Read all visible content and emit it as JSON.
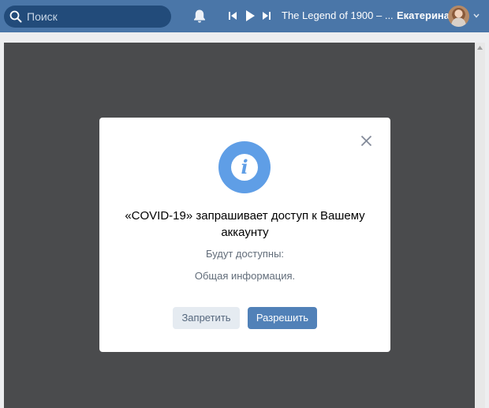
{
  "header": {
    "search_placeholder": "Поиск",
    "track_title": "The Legend of 1900 – ...",
    "user_name": "Екатерина",
    "icons": [
      "search-icon",
      "bell-icon",
      "prev-track-icon",
      "play-icon",
      "next-track-icon",
      "chevron-down-icon"
    ]
  },
  "dialog": {
    "title": "«COVID-19» запрашивает доступ к Вашему аккаунту",
    "subtitle": "Будут доступны:",
    "permission": "Общая информация.",
    "deny_label": "Запретить",
    "allow_label": "Разрешить",
    "info_glyph": "i",
    "icons": [
      "info-icon",
      "close-icon"
    ]
  },
  "colors": {
    "header": "#4a76a8",
    "search_bg": "#224b7a",
    "overlay": "#4a4b4d",
    "accent": "#5181b8",
    "info": "#5f9ee6"
  }
}
